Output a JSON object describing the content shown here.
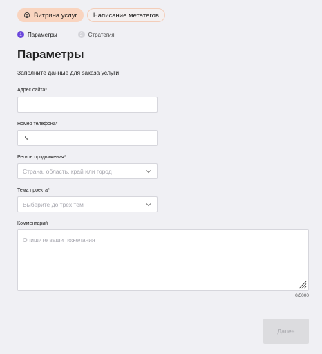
{
  "tabs": [
    {
      "label": "Витрина услуг",
      "icon": "gear-icon",
      "active": true
    },
    {
      "label": "Написание метатегов",
      "active": false
    }
  ],
  "stepper": {
    "steps": [
      {
        "number": "1",
        "label": "Параметры",
        "active": true
      },
      {
        "number": "2",
        "label": "Стратегия",
        "active": false
      }
    ]
  },
  "page": {
    "title": "Параметры",
    "subtitle": "Заполните данные для заказа услуги"
  },
  "form": {
    "site": {
      "label": "Адрес сайта*",
      "value": ""
    },
    "phone": {
      "label": "Номер телефона*",
      "value": "",
      "icon": "phone-icon"
    },
    "region": {
      "label": "Регион продвижения*",
      "placeholder": "Страна, область, край или город"
    },
    "topic": {
      "label": "Тема проекта*",
      "placeholder": "Выберите до трех тем"
    },
    "comment": {
      "label": "Комментарий",
      "placeholder": "Опишите ваши пожелания",
      "counter": "0/5000"
    }
  },
  "actions": {
    "next_label": "Далее"
  },
  "colors": {
    "accent": "#6b47dc",
    "chip_active": "#f9d4bf",
    "background": "#f0f0f4"
  }
}
